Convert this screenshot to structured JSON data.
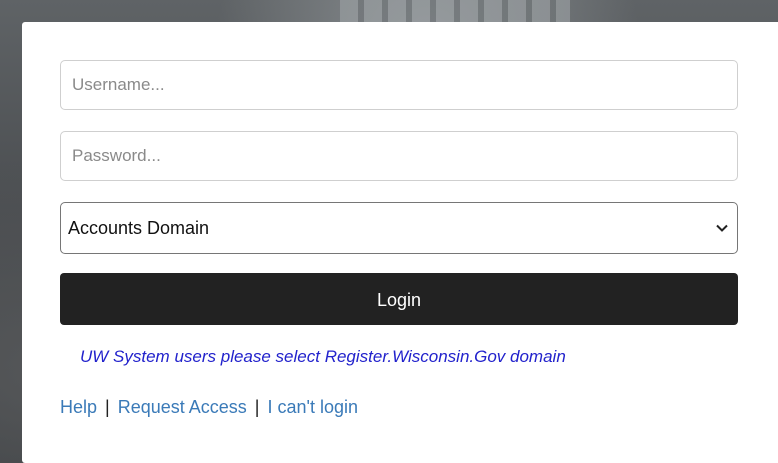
{
  "form": {
    "username": {
      "value": "",
      "placeholder": "Username..."
    },
    "password": {
      "value": "",
      "placeholder": "Password..."
    },
    "domain": {
      "selected": "Accounts Domain",
      "icon": "chevron-down-icon"
    },
    "login_label": "Login",
    "note": "UW System users please select Register.Wisconsin.Gov domain"
  },
  "links": {
    "help": "Help",
    "request_access": "Request Access",
    "cant_login": "I can't login",
    "separator": "|"
  },
  "colors": {
    "button_bg": "#222222",
    "link": "#3a7ab8",
    "note": "#2222cc"
  }
}
